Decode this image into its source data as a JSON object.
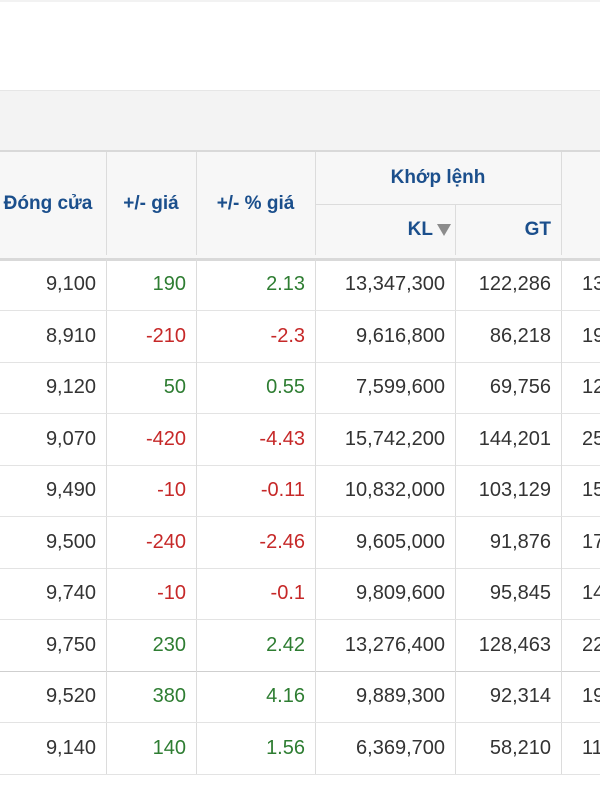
{
  "headers": {
    "close": "Đóng cửa",
    "change": "+/- giá",
    "change_pct": "+/- % giá",
    "matched": "Khớp lệnh",
    "kl": "KL",
    "gt": "GT"
  },
  "rows": [
    {
      "close": "9,100",
      "change": "190",
      "pct": "2.13",
      "kl": "13,347,300",
      "gt": "122,286",
      "next": "13",
      "dir": "pos"
    },
    {
      "close": "8,910",
      "change": "-210",
      "pct": "-2.3",
      "kl": "9,616,800",
      "gt": "86,218",
      "next": "19",
      "dir": "neg"
    },
    {
      "close": "9,120",
      "change": "50",
      "pct": "0.55",
      "kl": "7,599,600",
      "gt": "69,756",
      "next": "12",
      "dir": "pos"
    },
    {
      "close": "9,070",
      "change": "-420",
      "pct": "-4.43",
      "kl": "15,742,200",
      "gt": "144,201",
      "next": "25",
      "dir": "neg"
    },
    {
      "close": "9,490",
      "change": "-10",
      "pct": "-0.11",
      "kl": "10,832,000",
      "gt": "103,129",
      "next": "15",
      "dir": "neg"
    },
    {
      "close": "9,500",
      "change": "-240",
      "pct": "-2.46",
      "kl": "9,605,000",
      "gt": "91,876",
      "next": "17",
      "dir": "neg"
    },
    {
      "close": "9,740",
      "change": "-10",
      "pct": "-0.1",
      "kl": "9,809,600",
      "gt": "95,845",
      "next": "14",
      "dir": "neg"
    },
    {
      "close": "9,750",
      "change": "230",
      "pct": "2.42",
      "kl": "13,276,400",
      "gt": "128,463",
      "next": "22",
      "dir": "pos"
    },
    {
      "close": "9,520",
      "change": "380",
      "pct": "4.16",
      "kl": "9,889,300",
      "gt": "92,314",
      "next": "19",
      "dir": "pos"
    },
    {
      "close": "9,140",
      "change": "140",
      "pct": "1.56",
      "kl": "6,369,700",
      "gt": "58,210",
      "next": "11",
      "dir": "pos"
    }
  ],
  "colors": {
    "header_text": "#1b4f8c",
    "positive": "#2e7d32",
    "negative": "#c62828"
  }
}
